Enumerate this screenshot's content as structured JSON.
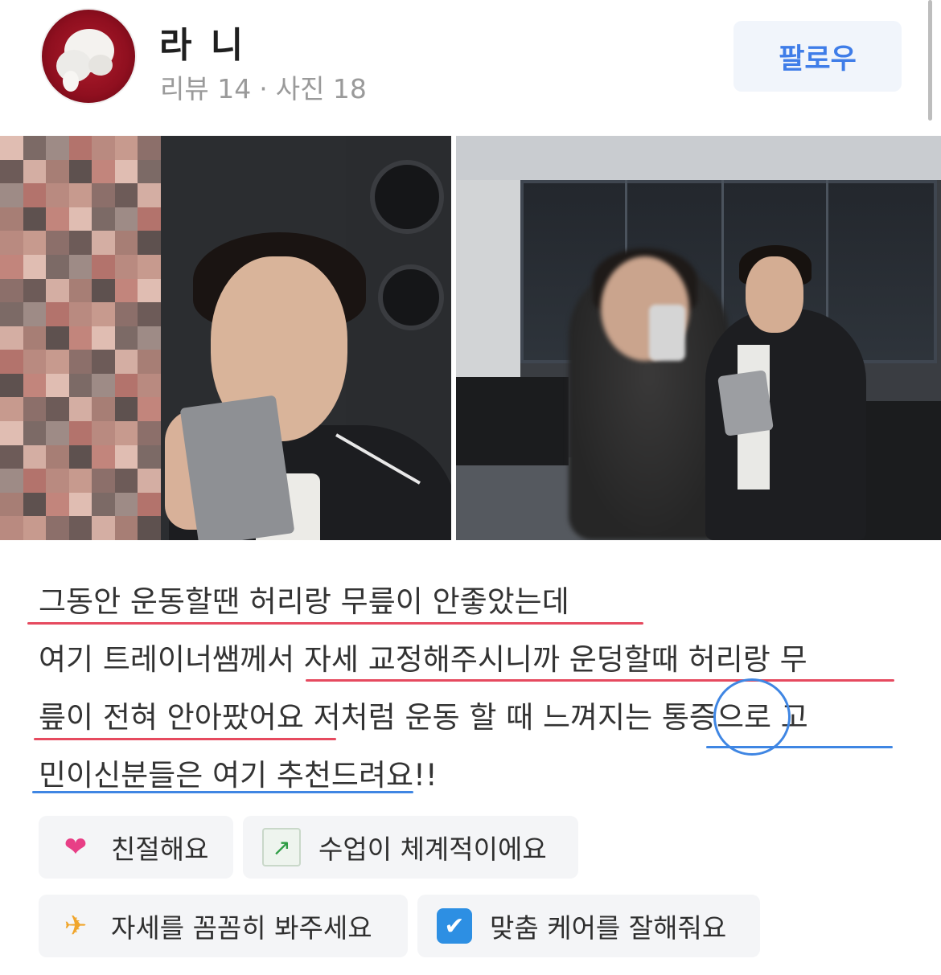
{
  "profile": {
    "name": "라 니",
    "review_count": "리뷰 14",
    "separator": "·",
    "photo_count": "사진 18",
    "follow_label": "팔로우"
  },
  "review": {
    "lines": [
      "그동안 운동할땐 허리랑 무릎이 안좋았는데",
      "여기 트레이너쌤께서 자세 교정해주시니까 운덩할때 허리랑 무",
      "릎이 전혀 안아팠어요 저처럼 운동 할 때 느껴지는 통증으로 고",
      "민이신분들은 여기 추천드려요!!"
    ]
  },
  "tags": [
    {
      "icon": "heart-icon",
      "label": "친절해요"
    },
    {
      "icon": "chart-increasing-icon",
      "label": "수업이 체계적이에요"
    },
    {
      "icon": "lunge-person-icon",
      "label": "자세를 꼼꼼히 봐주세요"
    },
    {
      "icon": "check-box-icon",
      "label": "맞춤 케어를 잘해줘요"
    }
  ],
  "colors": {
    "accent_blue": "#3f7de8",
    "underline_red": "#e64a5f",
    "underline_blue": "#3f86e3"
  }
}
